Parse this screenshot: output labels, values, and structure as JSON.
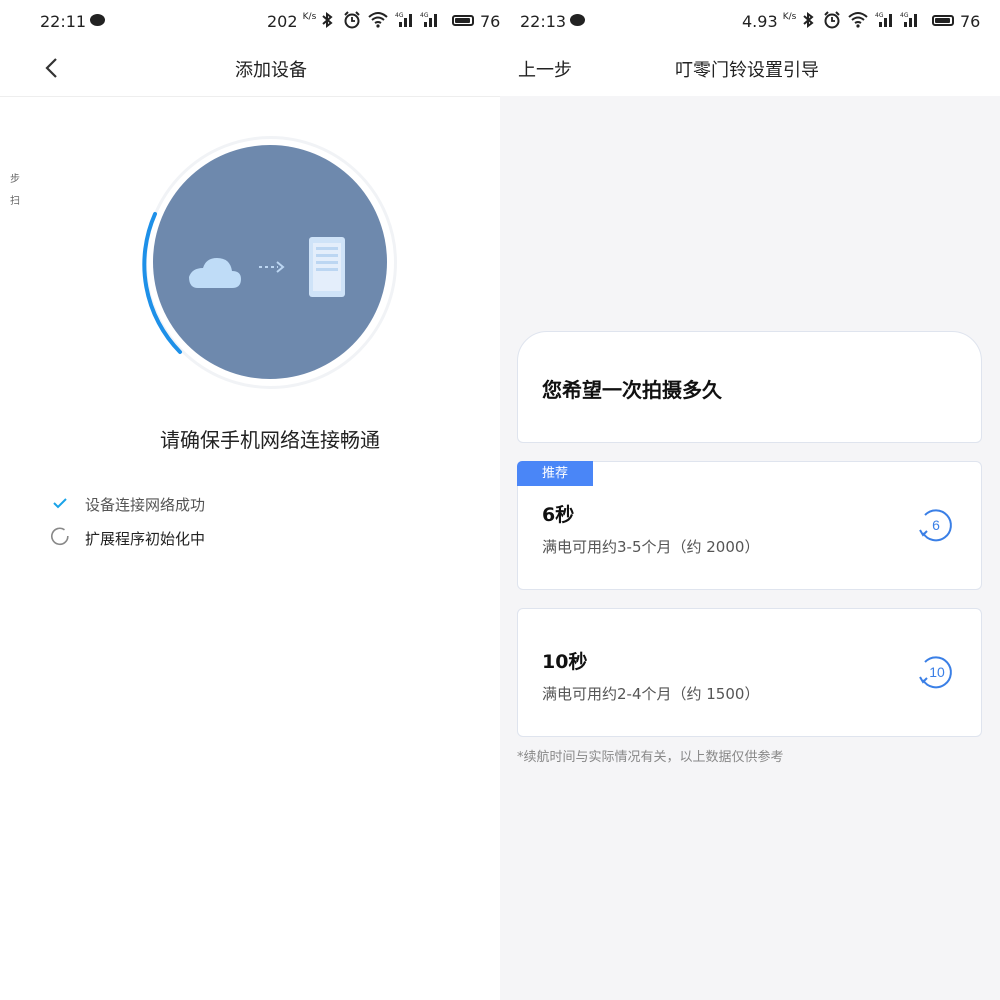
{
  "left": {
    "status": {
      "time": "22:11",
      "speed": "202",
      "speed_unit": "K/s",
      "battery": "76"
    },
    "header": {
      "title": "添加设备"
    },
    "side_hints": [
      "步",
      "扫"
    ],
    "prompt": "请确保手机网络连接畅通",
    "steps": [
      {
        "label": "设备连接网络成功",
        "state": "done"
      },
      {
        "label": "扩展程序初始化中",
        "state": "loading"
      }
    ]
  },
  "right": {
    "status": {
      "time": "22:13",
      "speed": "4.93",
      "speed_unit": "K/s",
      "battery": "76"
    },
    "header": {
      "back_label": "上一步",
      "title": "叮零门铃设置引导"
    },
    "question": "您希望一次拍摄多久",
    "options": [
      {
        "badge": "推荐",
        "label": "6秒",
        "desc": "满电可用约3-5个月（约 2000）",
        "icon": "timer-6-icon",
        "icon_text": "6"
      },
      {
        "label": "10秒",
        "desc": "满电可用约2-4个月（约 1500）",
        "icon": "timer-10-icon",
        "icon_text": "10"
      }
    ],
    "footnote": "*续航时间与实际情况有关，以上数据仅供参考"
  },
  "colors": {
    "accent": "#4a86f7",
    "progress": "#1e90e8",
    "circle": "#6e89ad",
    "check": "#1aa3e8"
  }
}
